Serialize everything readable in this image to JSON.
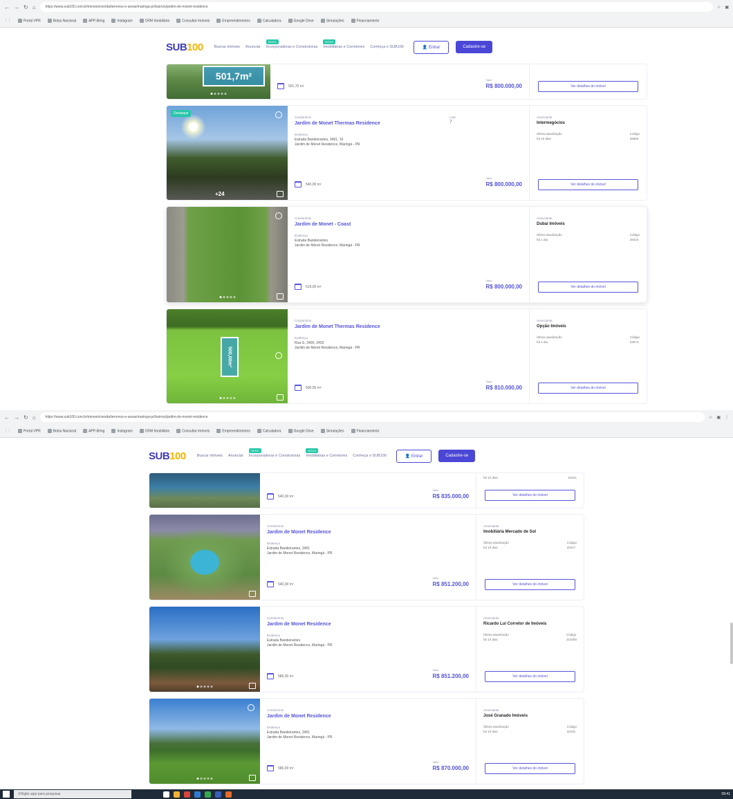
{
  "browser": {
    "url": "https://www.sub100.com.br/imoveis/venda/terrenos-e-areas/maringa-pr/bairros/jardim-de-monet-residence",
    "bookmarks": [
      "Portal VPR",
      "Bolsa Nacional",
      "APP-Bring",
      "Instagram",
      "CRM Imobiliário",
      "Consultar Imóveis",
      "Empreendimentos",
      "Calculadora",
      "Google Drive",
      "Simulações",
      "Financiamento"
    ]
  },
  "site": {
    "logo_main": "SUB",
    "logo_accent": "100",
    "nav": [
      {
        "label": "Buscar imóveis",
        "badge": ""
      },
      {
        "label": "Anunciar",
        "badge": ""
      },
      {
        "label": "Incorporadoras e Construtoras",
        "badge": "NOVO"
      },
      {
        "label": "Imobiliárias e Corretores",
        "badge": "NOVO"
      },
      {
        "label": "Conheça o SUB100",
        "badge": ""
      }
    ],
    "login_label": "Entrar",
    "signup_label": "Cadastre-se"
  },
  "listings_top": [
    {
      "photo_label": "501,7m²",
      "area": "501,70 m²",
      "price_label": "Valor",
      "price": "R$ 800.000,00",
      "button": "Ver detalhes do imóvel",
      "bg": "bg-aerial1"
    },
    {
      "tag": "Destaque",
      "condo_label": "Condomínio",
      "title": "Jardim de Monet Thermas Residence",
      "lote_label": "Lote",
      "lote": "7",
      "address_label": "Endereço",
      "address_1": "Estrada Bandeirantes, 3491, 16",
      "address_2": "Jardim de Monet Residence, Maringá - PR",
      "photo_count": "24",
      "area": "540,00 m²",
      "price_label": "Valor",
      "price": "R$ 800.000,00",
      "agent_label": "Anunciante",
      "agent": "Intermegócios",
      "stat_1_label": "Última atualização",
      "stat_1_value": "há 10 dias",
      "stat_2_label": "Código",
      "stat_2_value": "39880",
      "button": "Ver detalhes do imóvel",
      "bg": "bg-sunset"
    },
    {
      "condo_label": "Condomínio",
      "title": "Jardim de Monet - Coast",
      "address_label": "Endereço",
      "address_1": "Estrada Bandeirantes",
      "address_2": "Jardim de Monet Residence, Maringá - PR",
      "area": "619,00 m²",
      "price_label": "Valor",
      "price": "R$ 800.000,00",
      "agent_label": "Anunciante",
      "agent": "Dubai Imóveis",
      "stat_1_label": "Última atualização",
      "stat_1_value": "há 1 dia",
      "stat_2_label": "Código",
      "stat_2_value": "28310",
      "button": "Ver detalhes do imóvel",
      "bg": "bg-field"
    },
    {
      "photo_label": "500,00m²",
      "condo_label": "Condomínio",
      "title": "Jardim de Monet Thermas Residence",
      "address_label": "Endereço",
      "address_1": "Rua G, 2400, 2403",
      "address_2": "Jardim de Monet Residence, Maringá - PR",
      "area": "500,00 m²",
      "price_label": "Valor",
      "price": "R$ 810.000,00",
      "agent_label": "Anunciante",
      "agent": "Opção Imóveis",
      "stat_1_label": "Última atualização",
      "stat_1_value": "há 1 dia",
      "stat_2_label": "Código",
      "stat_2_value": "23973",
      "button": "Ver detalhes do imóvel",
      "bg": "bg-green"
    }
  ],
  "listings_bottom": [
    {
      "area": "540,00 m²",
      "price_label": "Valor",
      "price": "R$ 835.000,00",
      "stat_1_value": "há 10 dias",
      "stat_2_value": "18441",
      "button": "Ver detalhes do imóvel",
      "bg": "bg-pool"
    },
    {
      "condo_label": "Condomínio",
      "title": "Jardim de Monet Residence",
      "address_label": "Endereço",
      "address_1": "Estrada Bandeirantes, 3491",
      "address_2": "Jardim de Monet Residence, Maringá - PR",
      "area": "540,00 m²",
      "price_label": "Valor",
      "price": "R$ 851.200,00",
      "agent_label": "Anunciante",
      "agent": "Imobiliária Mercado de Sol",
      "stat_1_label": "Última atualização",
      "stat_1_value": "há 10 dias",
      "stat_2_label": "Código",
      "stat_2_value": "29417",
      "button": "Ver detalhes do imóvel",
      "bg": "bg-resort"
    },
    {
      "condo_label": "Condomínio",
      "title": "Jardim de Monet Residence",
      "address_label": "Endereço",
      "address_1": "Estrada Bandeirantes",
      "address_2": "Jardim de Monet Residence, Maringá - PR",
      "area": "586,00 m²",
      "price_label": "Valor",
      "price": "R$ 851.200,00",
      "agent_label": "Anunciante",
      "agent": "Ricardo Lui Corretor de Imóveis",
      "stat_1_label": "Última atualização",
      "stat_1_value": "há 10 dias",
      "stat_2_label": "Código",
      "stat_2_value": "310400",
      "button": "Ver detalhes do imóvel",
      "bg": "bg-trees"
    },
    {
      "condo_label": "Condomínio",
      "title": "Jardim de Monet Residence",
      "address_label": "Endereço",
      "address_1": "Estrada Bandeirantes, 3491",
      "address_2": "Jardim de Monet Residence, Maringá - PR",
      "area": "586,00 m²",
      "price_label": "Valor",
      "price": "R$ 870.000,00",
      "agent_label": "Anunciante",
      "agent": "José Granado Imóveis",
      "stat_1_label": "Última atualização",
      "stat_1_value": "há 10 dias",
      "stat_2_label": "Código",
      "stat_2_value": "32191",
      "button": "Ver detalhes do imóvel",
      "bg": "bg-lawn"
    }
  ],
  "taskbar": {
    "search_placeholder": "Digite aqui para pesquisar",
    "clock": "09:41"
  },
  "colors": {
    "brand": "#4b47d6",
    "accent": "#27c7a8",
    "logo_yellow": "#f3b300"
  }
}
